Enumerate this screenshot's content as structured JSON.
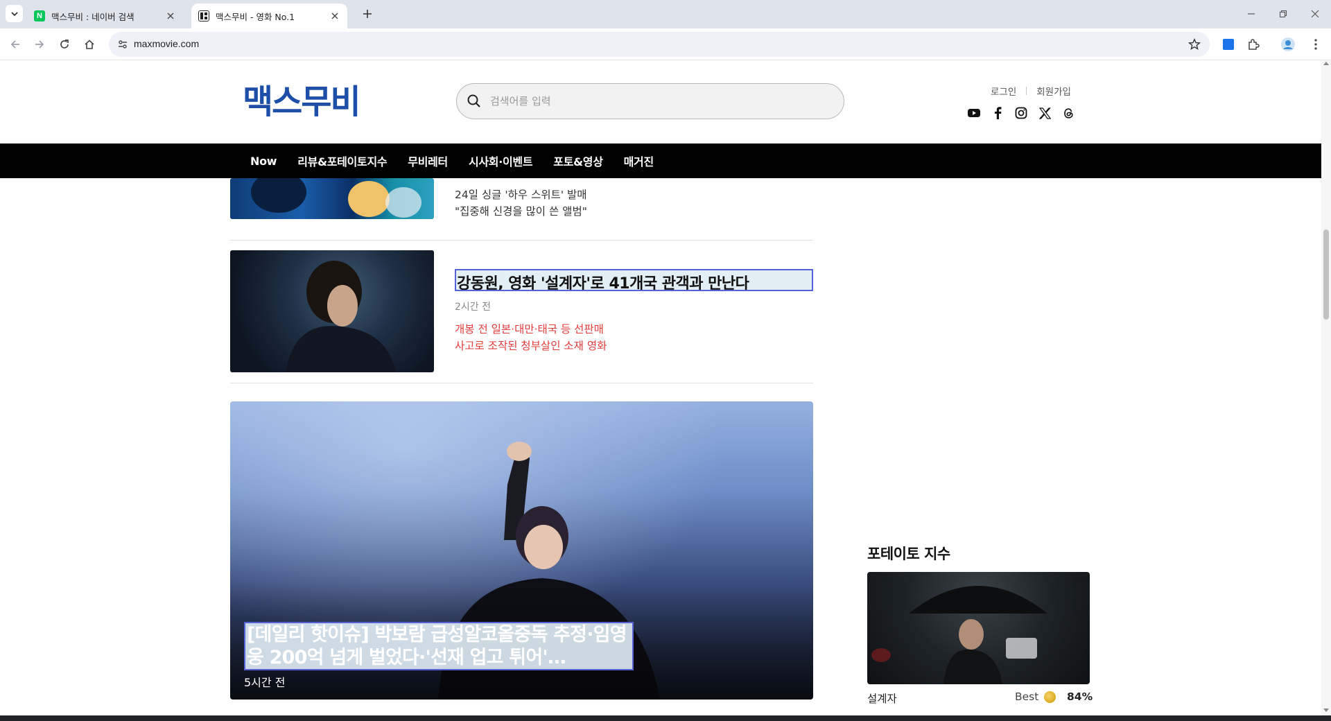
{
  "browser": {
    "tabs": [
      {
        "title": "맥스무비 : 네이버 검색",
        "favicon": "naver-icon",
        "active": false
      },
      {
        "title": "맥스무비 - 영화 No.1",
        "favicon": "maxmovie-icon",
        "active": true
      }
    ],
    "url": "maxmovie.com"
  },
  "header": {
    "logo": "맥스무비",
    "search_placeholder": "검색어를 입력",
    "login": "로그인",
    "signup": "회원가입",
    "socials": [
      "youtube-icon",
      "facebook-icon",
      "instagram-icon",
      "x-icon",
      "threads-icon"
    ]
  },
  "nav": {
    "items": [
      "Now",
      "리뷰&포테이토지수",
      "무비레터",
      "시사회·이벤트",
      "포토&영상",
      "매거진"
    ]
  },
  "articles": [
    {
      "lines": [
        "24일 싱글 '하우 스위트' 발매",
        "\"집중해 신경을 많이 쓴 앨범\""
      ]
    },
    {
      "title": "강동원, 영화 '설계자'로 41개국 관객과 만난다",
      "time": "2시간 전",
      "lines": [
        "개봉 전 일본·대만·태국 등 선판매",
        "사고로 조작된 청부살인 소재 영화"
      ]
    }
  ],
  "featured": {
    "title": "[데일리 핫이슈] 박보람 급성알코올중독 추정·임영웅 200억 넘게 벌었다·'선재 업고 튀어'…",
    "time": "5시간 전"
  },
  "sidebar": {
    "title": "포테이토 지수",
    "movie_name": "설계자",
    "grade": "Best",
    "percent": "84%"
  },
  "colors": {
    "logo": "#1d4fa8",
    "nav_bg": "#000000",
    "highlight_border": "#5561d6",
    "red_text": "#e23b3b"
  }
}
